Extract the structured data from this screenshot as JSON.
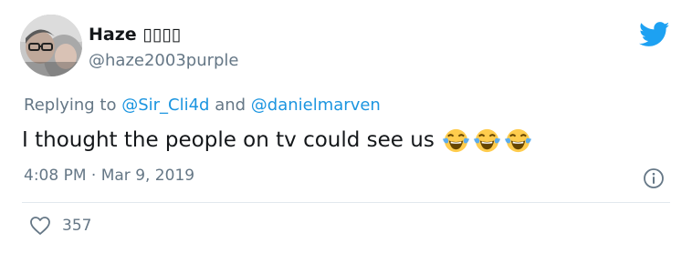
{
  "tweet": {
    "display_name": "Haze ▯▯▯▯",
    "handle": "@haze2003purple",
    "replying_prefix": "Replying to ",
    "reply_user_1": "@Sir_Cli4d",
    "reply_and": " and ",
    "reply_user_2": "@danielmarven",
    "text": "I thought the people on tv could see us",
    "emojis": [
      "face-with-tears-of-joy",
      "face-with-tears-of-joy",
      "face-with-tears-of-joy"
    ],
    "timestamp": "4:08 PM · Mar 9, 2019",
    "likes": "357"
  },
  "colors": {
    "brand": "#1da1f2",
    "link": "#1b95e0",
    "secondary_text": "#657786",
    "divider": "#e1e8ed"
  },
  "icons": {
    "brand": "twitter-bird-icon",
    "info": "info-icon",
    "like": "heart-icon",
    "emoji": "face-with-tears-of-joy-icon"
  }
}
